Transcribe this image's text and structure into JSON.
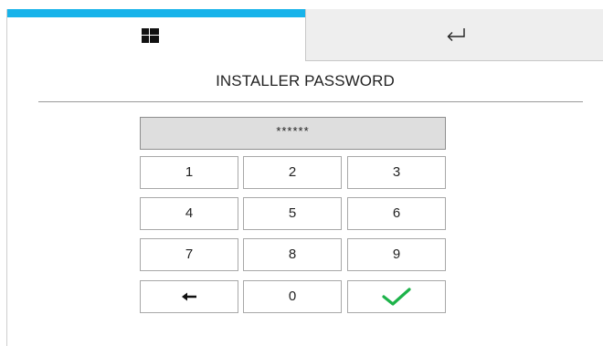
{
  "header": {
    "tabs": [
      {
        "icon": "grid-icon",
        "accent_color": "#17b3ea"
      },
      {
        "icon": "return-arrow-icon"
      }
    ]
  },
  "title": "INSTALLER PASSWORD",
  "password_display": "******",
  "keypad": {
    "keys": [
      "1",
      "2",
      "3",
      "4",
      "5",
      "6",
      "7",
      "8",
      "9",
      "0"
    ],
    "backspace_icon": "backspace-arrow-icon",
    "confirm_icon": "checkmark-icon",
    "confirm_color": "#1db34a"
  }
}
